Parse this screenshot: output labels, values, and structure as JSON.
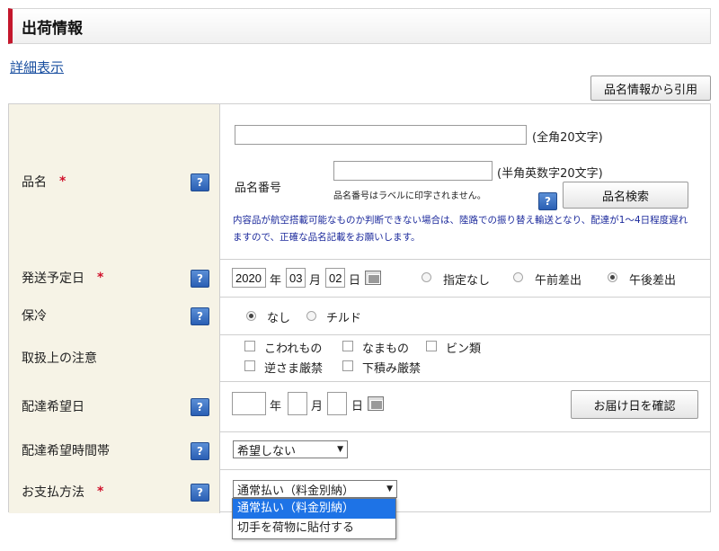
{
  "section": {
    "title": "出荷情報"
  },
  "links": {
    "detail": "詳細表示"
  },
  "buttons": {
    "cite_product": "品名情報から引用",
    "product_search": "品名検索",
    "confirm_delivery": "お届け日を確認"
  },
  "help_icon": "?",
  "required_mark": "*",
  "rows": {
    "product": {
      "label": "品名",
      "name_value": "",
      "name_hint": "(全角20文字)",
      "code_label": "品名番号",
      "code_value": "",
      "code_hint": "(半角英数字20文字)",
      "code_note": "品名番号はラベルに印字されません。",
      "notice_line1": "内容品が航空搭載可能なものか判断できない場合は、陸路での振り替え輸送となり、配達が1～4日程度遅れ",
      "notice_line2": "ますので、正確な品名記載をお願いします。"
    },
    "ship_date": {
      "label": "発送予定日",
      "year": "2020",
      "year_unit": "年",
      "month": "03",
      "month_unit": "月",
      "day": "02",
      "day_unit": "日",
      "options": [
        "指定なし",
        "午前差出",
        "午後差出"
      ],
      "selected": "午後差出"
    },
    "cool": {
      "label": "保冷",
      "options": [
        "なし",
        "チルド"
      ],
      "selected": "なし"
    },
    "handling": {
      "label": "取扱上の注意",
      "options": [
        "こわれもの",
        "なまもの",
        "ビン類",
        "逆さま厳禁",
        "下積み厳禁"
      ]
    },
    "delivery_date": {
      "label": "配達希望日",
      "year_value": "",
      "year_unit": "年",
      "month_value": "",
      "month_unit": "月",
      "day_value": "",
      "day_unit": "日"
    },
    "delivery_time": {
      "label": "配達希望時間帯",
      "selected": "希望しない"
    },
    "payment": {
      "label": "お支払方法",
      "selected": "通常払い（料金別納）",
      "options": [
        "通常払い（料金別納）",
        "切手を荷物に貼付する"
      ]
    }
  }
}
